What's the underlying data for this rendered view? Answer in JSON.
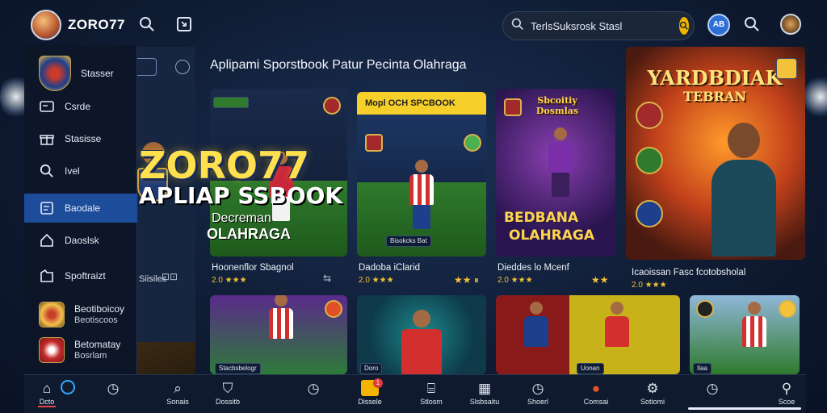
{
  "header": {
    "brand": "ZORO77",
    "search_value": "TerlsSuksrosk Stasl",
    "search_placeholder": "TerlsSuksrosk Stasl",
    "badge_text": "AB",
    "accent": "#1d4d9a",
    "search_button_color": "#f3b400"
  },
  "sidebar": {
    "items": [
      {
        "icon": "club-crest",
        "label": "Stasser"
      },
      {
        "icon": "card-icon",
        "label": "Csrde"
      },
      {
        "icon": "gift-icon",
        "label": "Stasisse"
      },
      {
        "icon": "search-icon",
        "label": "Ivel"
      },
      {
        "icon": "card-icon",
        "label": "Baodale"
      },
      {
        "icon": "home-icon",
        "label": "Daoslsk"
      },
      {
        "icon": "folder-icon",
        "label": "Spoftraizt"
      },
      {
        "icon": "club-crest",
        "label": "Beotiboicoy",
        "sub": "Beotiscoos"
      },
      {
        "icon": "club-crest",
        "label": "Betomatay",
        "sub": "Bosrlam"
      }
    ]
  },
  "main": {
    "section_title": "Aplipami Sporstbook Patur Pecinta Olahraga",
    "left_peek_text": "Siisiles",
    "hero": {
      "line1": "ZORO77",
      "line2": "APLIAP SSBOOK",
      "line3": "Decreman",
      "line4": "OLAHRAGA"
    },
    "cards_row1": [
      {
        "title": "Hoonenflor Sbagnol",
        "rating": "2.0 ★★★",
        "chip": "",
        "flag": ""
      },
      {
        "title": "Dadoba iClarid",
        "rating": "2.0 ★★★",
        "banner": "Mopl OCH SPCBOOK",
        "chip": "Bisokcks Bat"
      },
      {
        "title": "Dieddes lo Mcenf",
        "rating": "2.0 ★★★",
        "top": "Sbcoitiy Dosmlas",
        "big1": "BEDBANA",
        "big2": "OLAHRAGA"
      },
      {
        "title": "Icaoissan Fasc fcotobsholal",
        "rating": "2.0 ★★★",
        "top1": "YARDBDIAK",
        "top2": "TEBRAN"
      }
    ],
    "row2_chips": [
      "Stacbsbelogr",
      "Doro",
      "Uonan",
      "Ilaa"
    ]
  },
  "bottom_nav": {
    "items": [
      {
        "icon": "home-icon",
        "label": "Dcto"
      },
      {
        "icon": "ring-icon",
        "label": ""
      },
      {
        "icon": "clock-icon",
        "label": ""
      },
      {
        "icon": "search-icon",
        "label": "Sonais"
      },
      {
        "icon": "shield-icon",
        "label": "Dossitb"
      },
      {
        "icon": "clock-icon",
        "label": ""
      },
      {
        "icon": "ticket-icon",
        "label": "Dissele",
        "notif": "1"
      },
      {
        "icon": "gift-icon",
        "label": "Stlosm"
      },
      {
        "icon": "calendar-icon",
        "label": "Slsbsaitu"
      },
      {
        "icon": "clock-icon",
        "label": "Shoerl"
      },
      {
        "icon": "chat-icon",
        "label": "Comsai"
      },
      {
        "icon": "settings-icon",
        "label": "Sotiomi"
      },
      {
        "icon": "clock-icon",
        "label": ""
      },
      {
        "icon": "user-icon",
        "label": "Scoe"
      }
    ]
  }
}
